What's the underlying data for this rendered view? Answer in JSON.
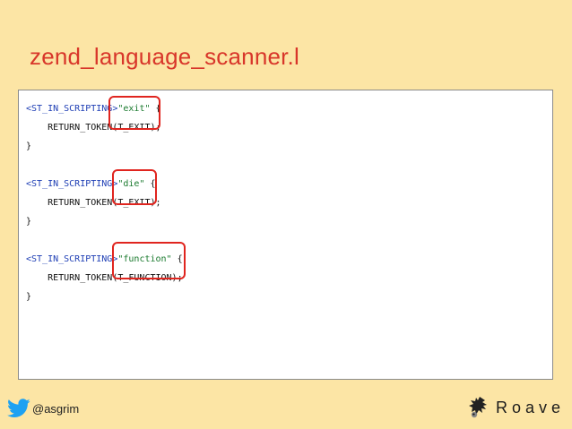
{
  "slide": {
    "title": "zend_language_scanner.l"
  },
  "code": {
    "blocks": [
      {
        "tag": "<ST_IN_SCRIPTING>",
        "keyword": "\"exit\"",
        "brace": " {",
        "body": "    RETURN_TOKEN(T_EXIT);",
        "close": "}"
      },
      {
        "tag": "<ST_IN_SCRIPTING>",
        "keyword": "\"die\"",
        "brace": " {",
        "body": "    RETURN_TOKEN(T_EXIT);",
        "close": "}"
      },
      {
        "tag": "<ST_IN_SCRIPTING>",
        "keyword": "\"function\"",
        "brace": " {",
        "body": "    RETURN_TOKEN(T_FUNCTION);",
        "close": "}"
      }
    ]
  },
  "footer": {
    "handle": "@asgrim",
    "brand": "Roave",
    "icons": [
      "twitter-icon",
      "roave-logo-icon"
    ]
  },
  "colors": {
    "background": "#fce5a5",
    "title": "#d8362a",
    "highlight": "#e0251f",
    "twitter": "#1da1f2"
  }
}
